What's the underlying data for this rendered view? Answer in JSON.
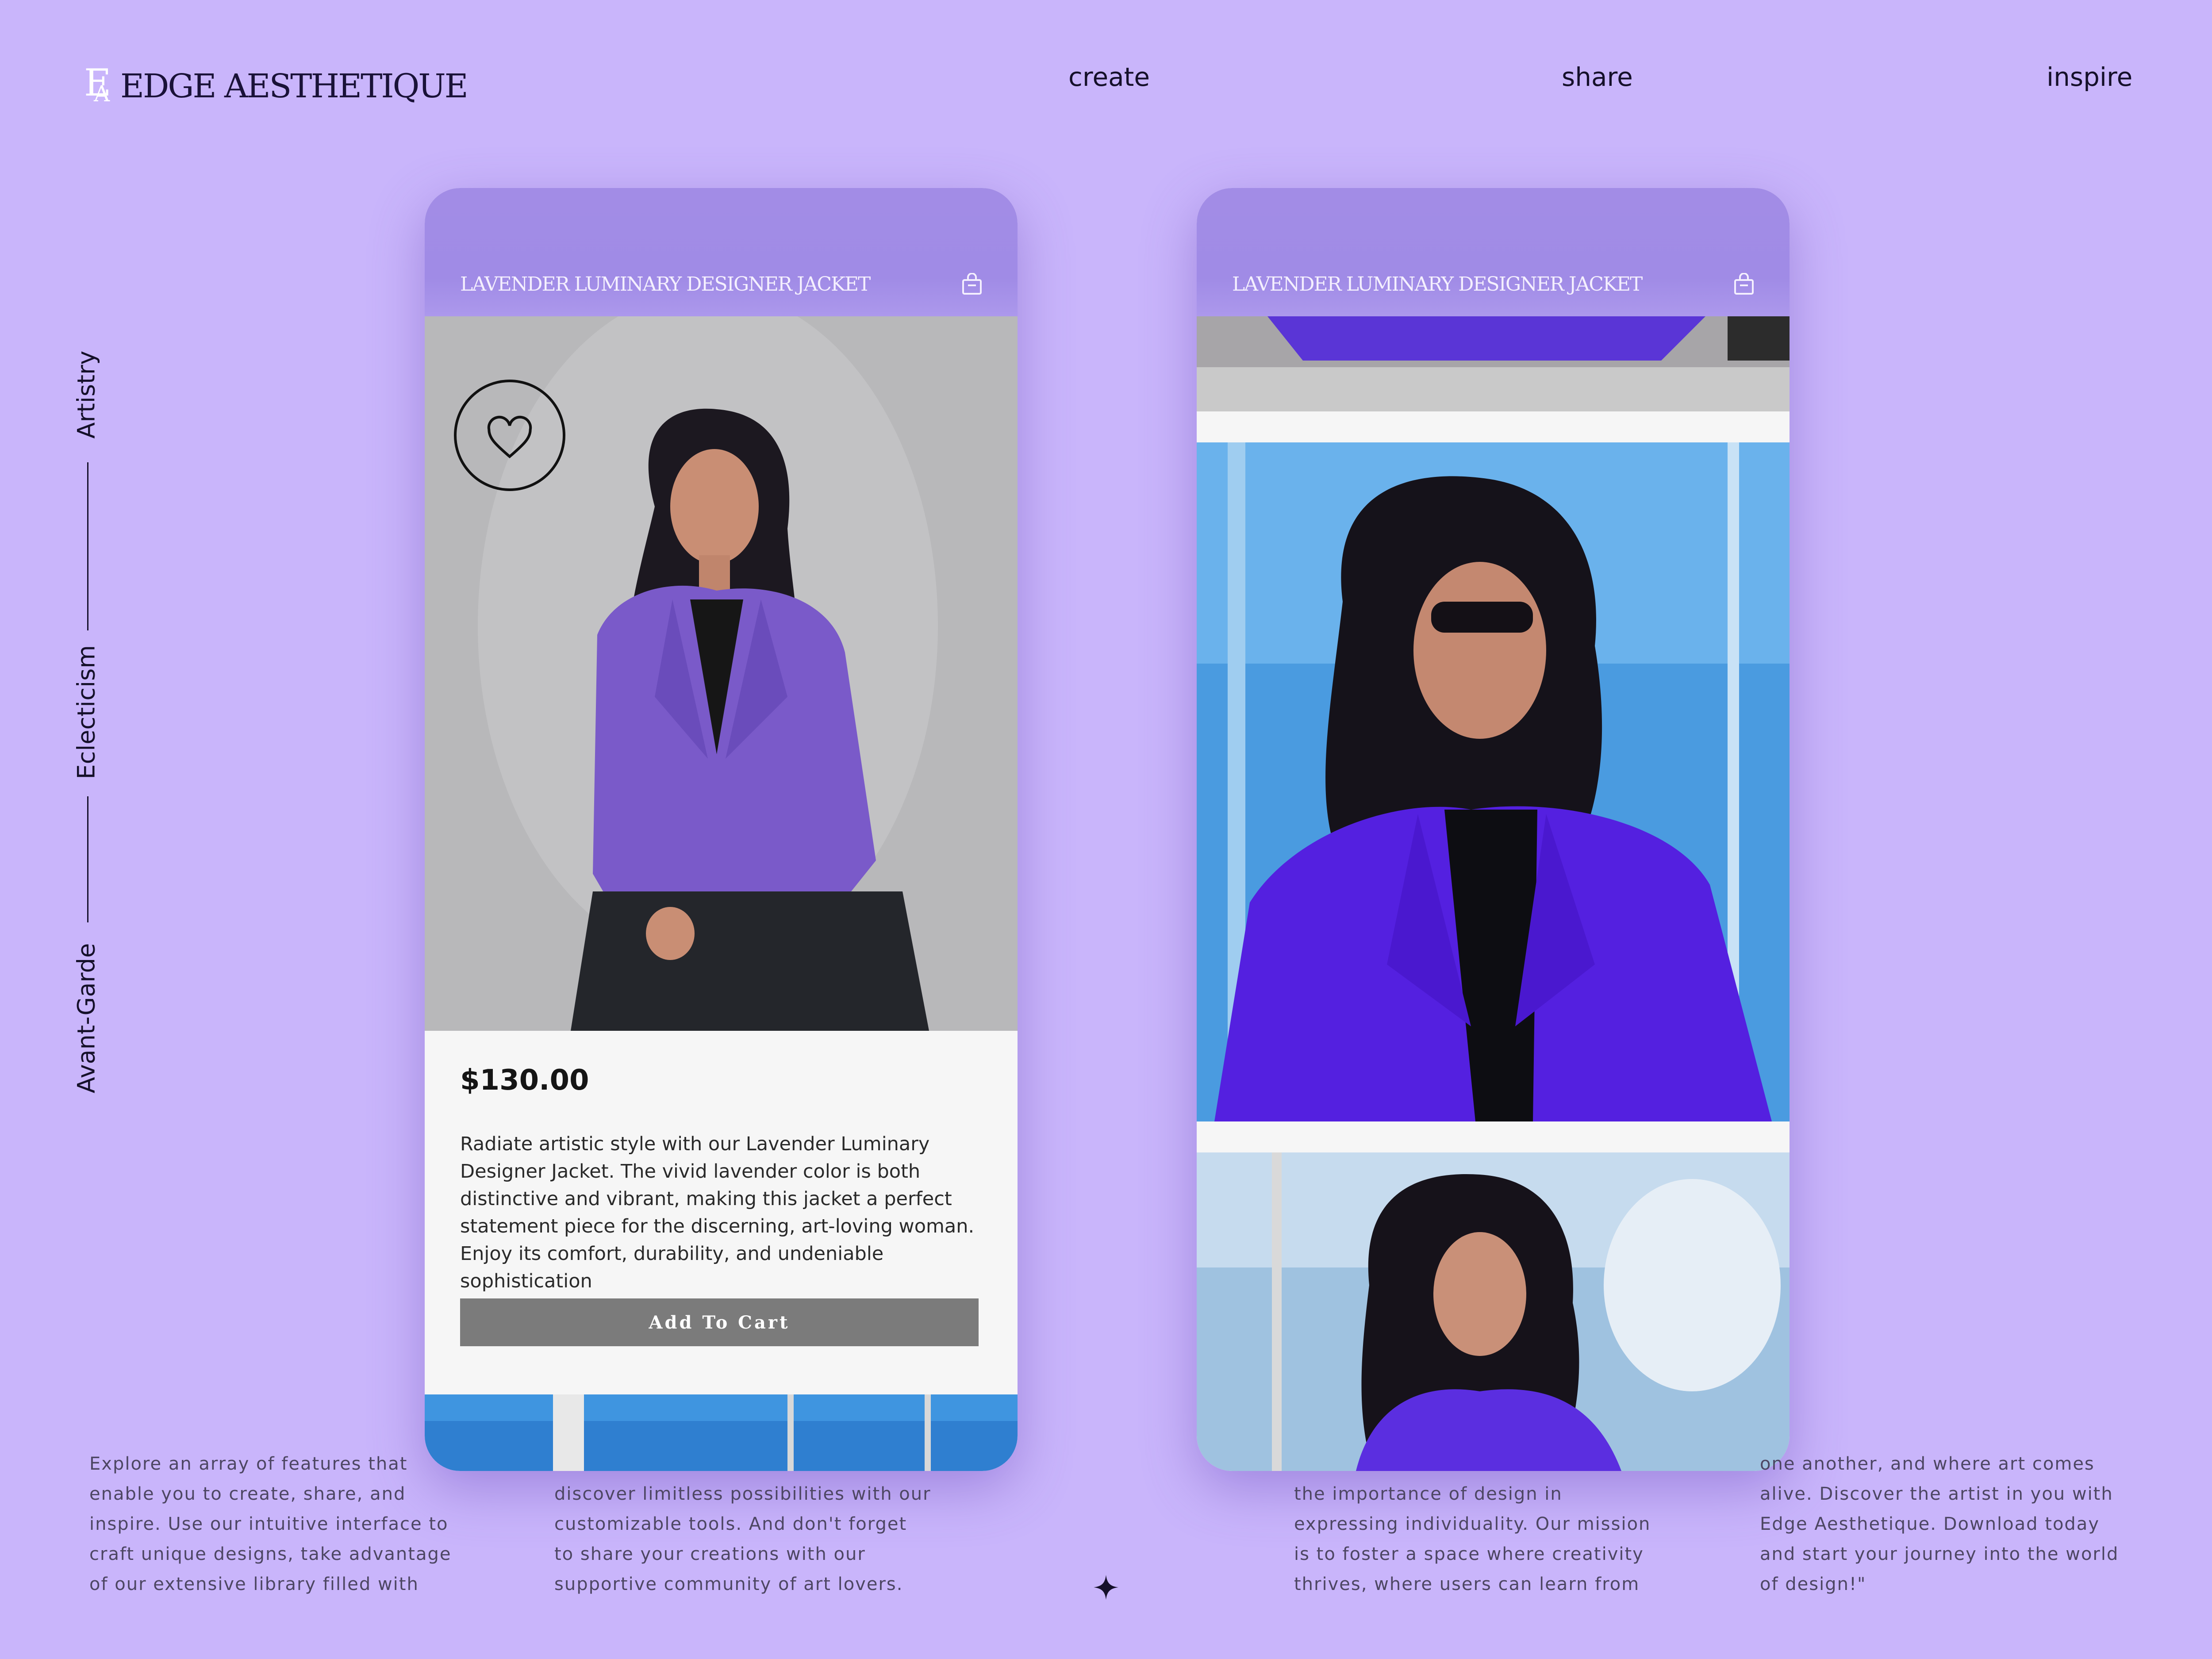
{
  "brand": {
    "name": "EDGE AESTHETIQUE",
    "mark_e": "E",
    "mark_a": "A"
  },
  "nav": {
    "items": [
      "create",
      "share",
      "inspire"
    ]
  },
  "side_labels": [
    "Artistry",
    "Eclecticism",
    "Avant-Garde"
  ],
  "product": {
    "title": "LAVENDER LUMINARY DESIGNER JACKET",
    "price": "$130.00",
    "description": "Radiate artistic style with our Lavender Luminary Designer Jacket. The vivid lavender color is both distinctive and vibrant, making this jacket a perfect statement piece for the discerning, art-loving woman. Enjoy its comfort, durability, and undeniable sophistication",
    "add_to_cart": "Add To Cart"
  },
  "icons": {
    "bag": "shopping-bag-icon",
    "favorite": "heart-icon",
    "decor": "sparkle-icon"
  },
  "colors": {
    "background": "#c9b5fb",
    "phone_header": "#a28ce6",
    "jacket": "#5b2ee0",
    "button": "#7b7b7b"
  },
  "footer_paragraphs": [
    [
      "Explore an array of features that",
      "enable you to create, share, and",
      "inspire. Use our intuitive interface to",
      "craft unique designs, take advantage",
      "of our extensive library filled with"
    ],
    [
      "discover limitless possibilities with our",
      "customizable tools. And don't forget",
      "to share your creations with our",
      "supportive community of art lovers."
    ],
    [
      "the importance of design in",
      "expressing individuality. Our mission",
      "is to foster a space where creativity",
      "thrives, where users can learn from"
    ],
    [
      "one another, and where art comes",
      "alive. Discover the artist in you with",
      "Edge Aesthetique. Download today",
      "and start your journey into the world",
      "of design!\""
    ]
  ]
}
